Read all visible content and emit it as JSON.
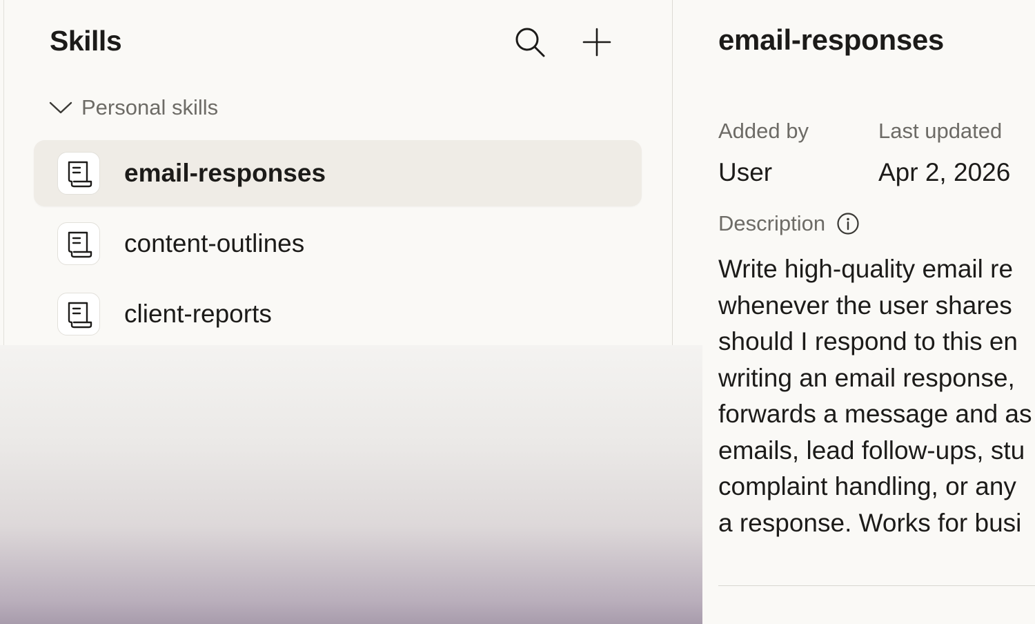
{
  "panel": {
    "title": "Skills",
    "search_icon": "search-icon",
    "add_icon": "plus-icon"
  },
  "section": {
    "label": "Personal skills",
    "icon": "chevron-down-icon"
  },
  "skills": [
    {
      "label": "email-responses",
      "icon": "scroll-icon",
      "selected": true
    },
    {
      "label": "content-outlines",
      "icon": "scroll-icon",
      "selected": false
    },
    {
      "label": "client-reports",
      "icon": "scroll-icon",
      "selected": false
    }
  ],
  "detail": {
    "title": "email-responses",
    "added_by_label": "Added by",
    "added_by_value": "User",
    "last_updated_label": "Last updated",
    "last_updated_value": "Apr 2, 2026",
    "description_label": "Description",
    "description_icon": "info-icon",
    "description_lines": [
      "Write high-quality email re",
      "whenever the user shares",
      "should I respond to this en",
      "writing an email response,",
      "forwards a message and as",
      "emails, lead follow-ups, stu",
      "complaint handling, or any",
      "a response. Works for busi"
    ]
  },
  "colors": {
    "background": "#faf9f6",
    "selected_row": "#efece6",
    "muted_text": "#6d6b66",
    "primary_text": "#1c1b19"
  }
}
